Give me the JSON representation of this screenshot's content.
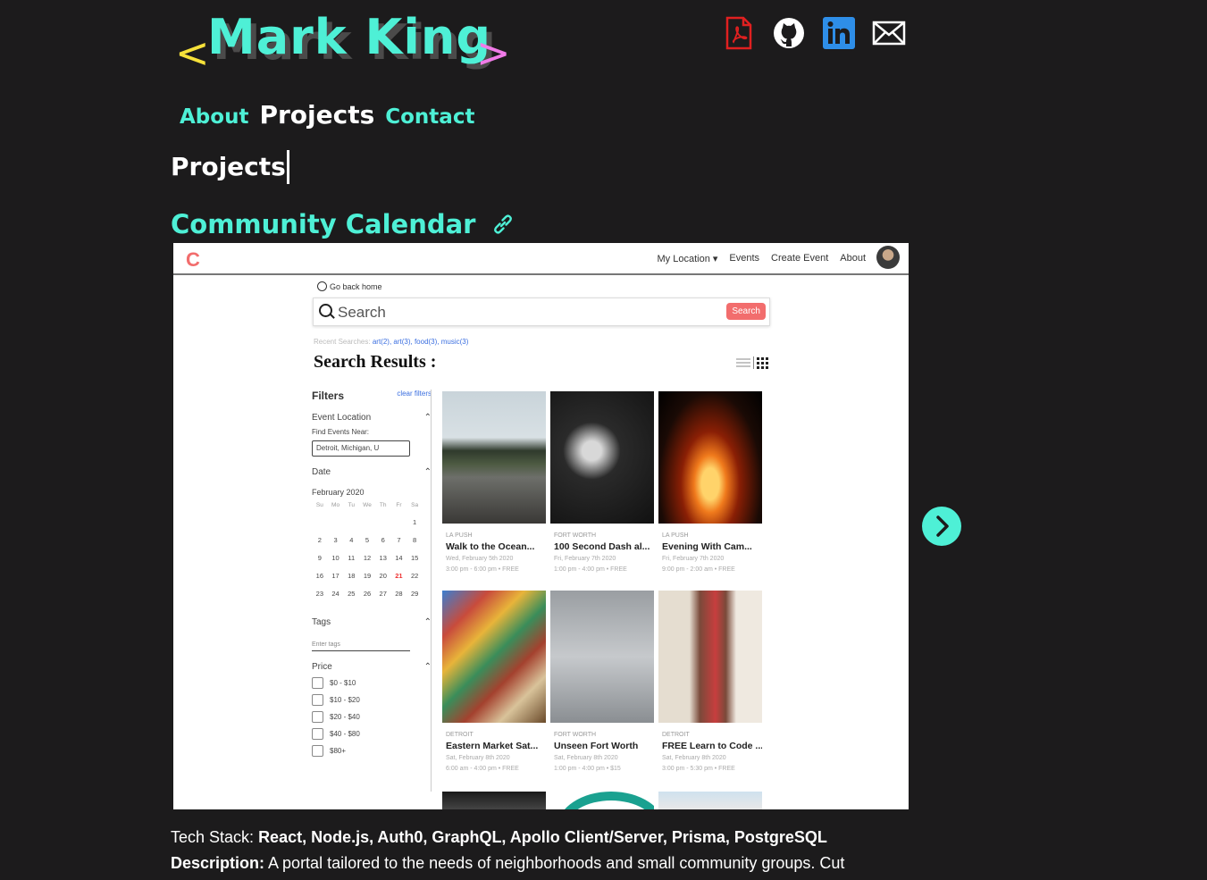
{
  "header": {
    "logo": {
      "left_bracket": "<",
      "name": "Mark King",
      "right_bracket": ">"
    },
    "social": [
      "pdf-resume-icon",
      "github-icon",
      "linkedin-icon",
      "email-icon"
    ],
    "social_colors": {
      "pdf": "#e02020",
      "github": "#ffffff",
      "linkedin": "#2e8ee8",
      "email": "#ffffff"
    }
  },
  "nav": {
    "items": [
      {
        "label": "About"
      },
      {
        "label": "Projects"
      },
      {
        "label": "Contact"
      }
    ],
    "active": "Projects"
  },
  "section_title": "Projects",
  "project": {
    "title": "Community Calendar",
    "link_icon": "link-icon",
    "tech_label": "Tech Stack:",
    "tech_value": "React, Node.js, Auth0, GraphQL, Apollo Client/Server, Prisma, PostgreSQL",
    "desc_label": "Description:",
    "desc_value": "A portal tailored to the needs of neighborhoods and small community groups. Cut"
  },
  "screenshot": {
    "logo": "C",
    "nav": {
      "location": "My Location ▾",
      "events": "Events",
      "create": "Create Event",
      "about": "About"
    },
    "go_back": "Go back home",
    "search_placeholder": "Search",
    "search_button": "Search",
    "recent_label": "Recent Searches:",
    "recent_values": "art(2), art(3), food(3), music(3)",
    "results_title": "Search Results :",
    "filters": {
      "title": "Filters",
      "clear": "clear filters",
      "event_location": "Event Location",
      "find_near": "Find Events Near:",
      "location_value": "Detroit, Michigan, U",
      "date": "Date",
      "month": "February 2020",
      "weekdays": [
        "Su",
        "Mo",
        "Tu",
        "We",
        "Th",
        "Fr",
        "Sa"
      ],
      "days": [
        "",
        "",
        "",
        "",
        "",
        "",
        "1",
        "2",
        "3",
        "4",
        "5",
        "6",
        "7",
        "8",
        "9",
        "10",
        "11",
        "12",
        "13",
        "14",
        "15",
        "16",
        "17",
        "18",
        "19",
        "20",
        "21",
        "22",
        "23",
        "24",
        "25",
        "26",
        "27",
        "28",
        "29"
      ],
      "today": "21",
      "tags": "Tags",
      "tags_placeholder": "Enter tags",
      "price": "Price",
      "price_options": [
        "$0 - $10",
        "$10 - $20",
        "$20 - $40",
        "$40 - $80",
        "$80+"
      ]
    },
    "cards": [
      {
        "city": "LA PUSH",
        "title": "Walk to the Ocean...",
        "date": "Wed, February 5th 2020",
        "time": "3:00 pm - 6:00 pm • FREE",
        "img": "sea-stack-photo"
      },
      {
        "city": "FORT WORTH",
        "title": "100 Second Dash al...",
        "date": "Fri, February 7th 2020",
        "time": "1:00 pm - 4:00 pm • FREE",
        "img": "concert-photo"
      },
      {
        "city": "LA PUSH",
        "title": "Evening With Cam...",
        "date": "Fri, February 7th 2020",
        "time": "9:00 pm - 2:00 am • FREE",
        "img": "campfire-photo"
      },
      {
        "city": "DETROIT",
        "title": "Eastern Market Sat...",
        "date": "Sat, February 8th 2020",
        "time": "6:00 am - 4:00 pm • FREE",
        "img": "market-photo"
      },
      {
        "city": "FORT WORTH",
        "title": "Unseen Fort Worth",
        "date": "Sat, February 8th 2020",
        "time": "1:00 pm - 4:00 pm • $15",
        "img": "antenna-photo"
      },
      {
        "city": "DETROIT",
        "title": "FREE Learn to Code ...",
        "date": "Sat, February 8th 2020",
        "time": "3:00 pm - 5:30 pm • FREE",
        "img": "speaker-photo"
      }
    ]
  },
  "carousel": {
    "next_icon": "chevron-right-icon"
  },
  "colors": {
    "accent": "#4ef0d6",
    "background": "#1c1b1c",
    "bracket_left": "#f6e13a",
    "bracket_right": "#f17be8",
    "app_accent": "#f26d6d"
  }
}
